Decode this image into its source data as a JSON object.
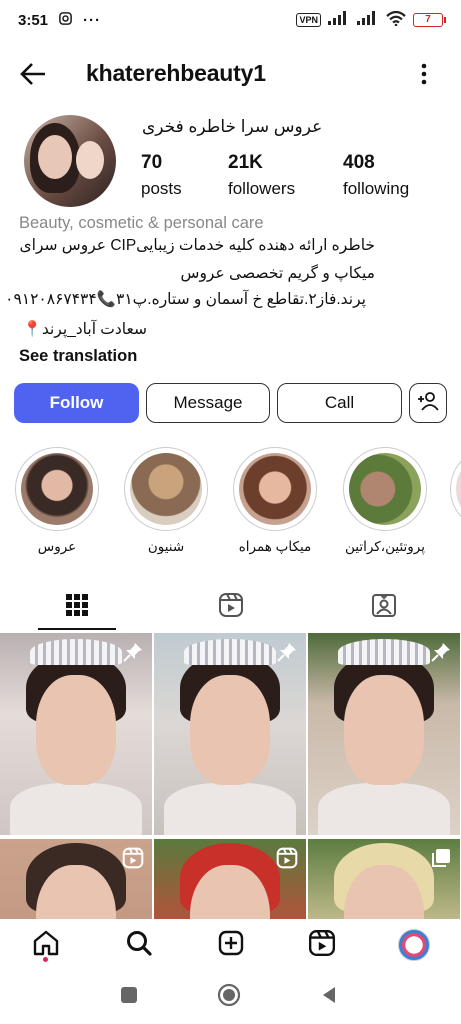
{
  "status": {
    "time": "3:51",
    "vpn": "VPN",
    "battery": "7"
  },
  "header": {
    "username": "khaterehbeauty1"
  },
  "profile": {
    "full_name": "عروس سرا خاطره فخری",
    "stats": [
      {
        "num": "70",
        "label": "posts"
      },
      {
        "num": "21K",
        "label": "followers"
      },
      {
        "num": "408",
        "label": "following"
      }
    ],
    "category": "Beauty, cosmetic & personal care",
    "bio_lines": [
      "خاطره ارائه دهنده کلیه خدمات زیباییCIP عروس سرای",
      "میکاپ و گریم تخصصی عروس",
      "پرند.فاز۲.تقاطع خ آسمان و ستاره.پ۳۱📞۰۹۱۲۰۸۶۷۴۳۴",
      "سعادت آباد_پرند📍"
    ],
    "see_translation": "See translation"
  },
  "buttons": {
    "follow": "Follow",
    "message": "Message",
    "call": "Call"
  },
  "highlights": [
    {
      "label": "عروس"
    },
    {
      "label": "شنیون"
    },
    {
      "label": "میکاپ همراه"
    },
    {
      "label": "پروتئین،کراتین"
    },
    {
      "label": ""
    }
  ],
  "colors": {
    "follow_bg": "#4f63f0",
    "accent_dot": "#e0245e"
  }
}
